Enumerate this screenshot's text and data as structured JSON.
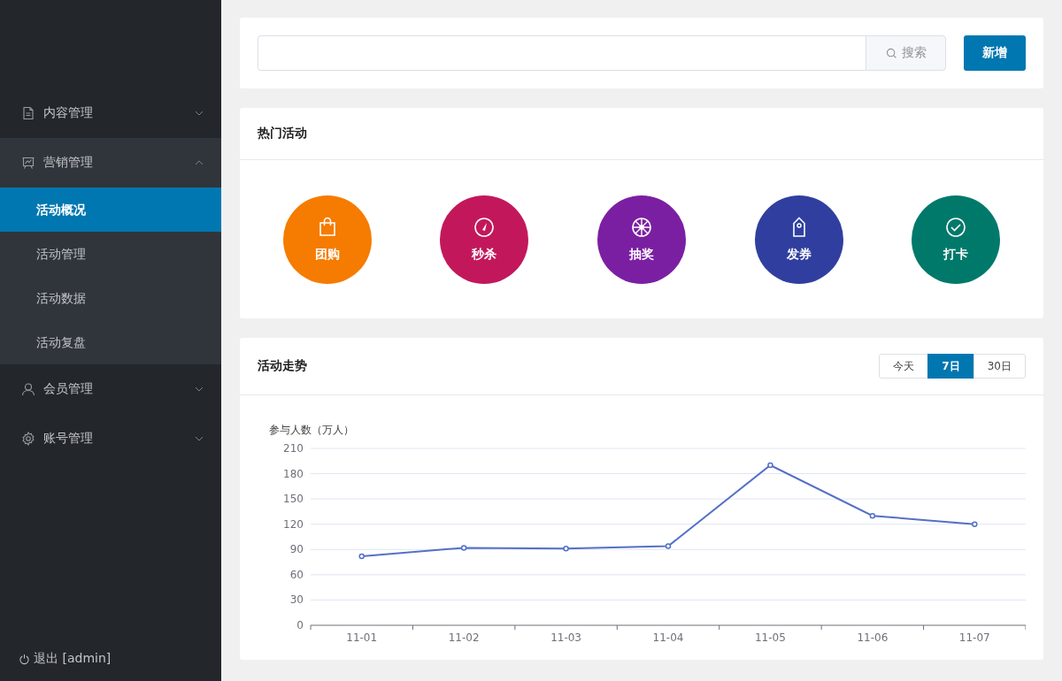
{
  "sidebar": {
    "menu": [
      {
        "label": "内容管理",
        "expanded": false
      },
      {
        "label": "营销管理",
        "expanded": true,
        "children": [
          {
            "label": "活动概况",
            "selected": true
          },
          {
            "label": "活动管理",
            "selected": false
          },
          {
            "label": "活动数据",
            "selected": false
          },
          {
            "label": "活动复盘",
            "selected": false
          }
        ]
      },
      {
        "label": "会员管理",
        "expanded": false
      },
      {
        "label": "账号管理",
        "expanded": false
      }
    ],
    "logout": "退出 [admin]"
  },
  "search": {
    "button": "搜索",
    "add_button": "新增"
  },
  "hot_activities": {
    "title": "热门活动",
    "items": [
      {
        "label": "团购",
        "color": "#f57c00"
      },
      {
        "label": "秒杀",
        "color": "#c2185b"
      },
      {
        "label": "抽奖",
        "color": "#7b1fa2"
      },
      {
        "label": "发券",
        "color": "#303f9f"
      },
      {
        "label": "打卡",
        "color": "#00796b"
      }
    ]
  },
  "trend": {
    "title": "活动走势",
    "ranges": [
      {
        "label": "今天",
        "selected": false
      },
      {
        "label": "7日",
        "selected": true
      },
      {
        "label": "30日",
        "selected": false
      }
    ],
    "chart_data": {
      "type": "line",
      "ylabel": "参与人数（万人）",
      "categories": [
        "11-01",
        "11-02",
        "11-03",
        "11-04",
        "11-05",
        "11-06",
        "11-07"
      ],
      "series": [
        {
          "color": "#5470c6",
          "marker": "circle",
          "values": [
            82,
            92,
            91,
            94,
            190,
            130,
            120
          ]
        }
      ],
      "grid": true,
      "ylim": [
        0,
        210
      ],
      "yticks": [
        0,
        30,
        60,
        90,
        120,
        150,
        180,
        210
      ]
    }
  }
}
